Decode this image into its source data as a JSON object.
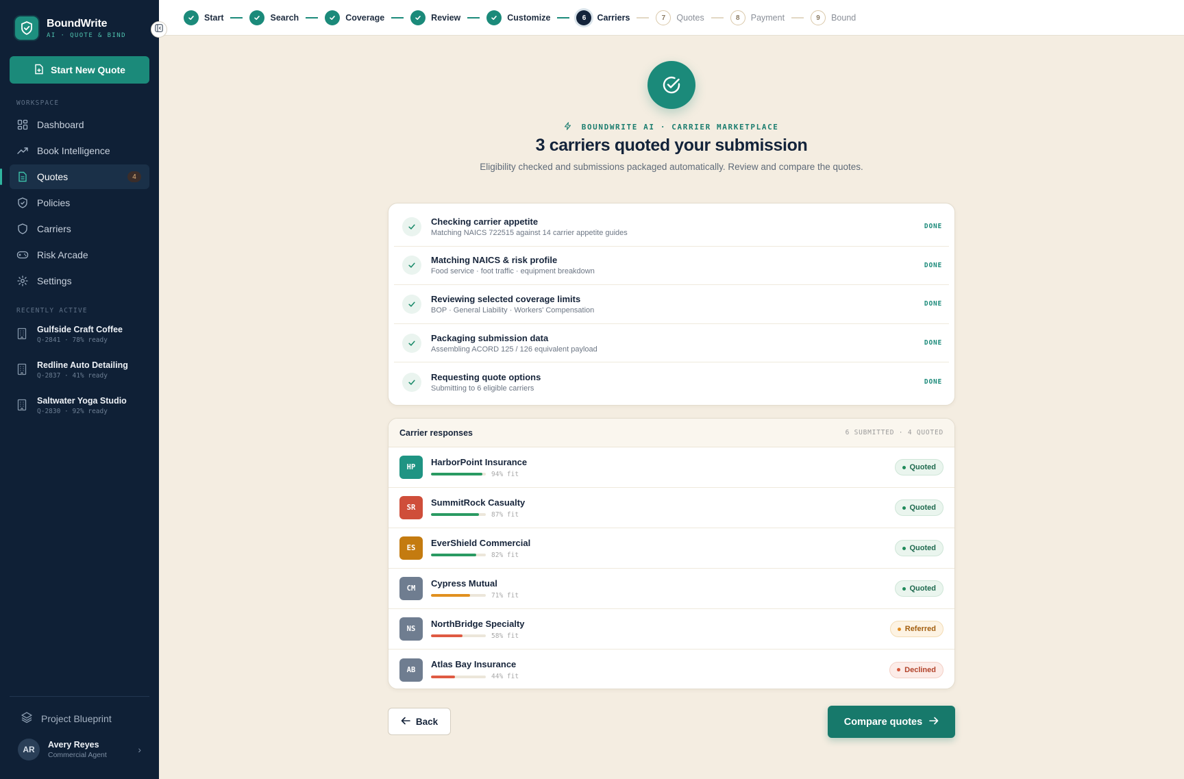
{
  "brand": {
    "name": "BoundWrite",
    "tagline": "AI · QUOTE & BIND"
  },
  "sidebar": {
    "new_quote_label": "Start New Quote",
    "workspace_label": "WORKSPACE",
    "nav": [
      {
        "label": "Dashboard",
        "icon": "grid-icon"
      },
      {
        "label": "Book Intelligence",
        "icon": "trend-icon"
      },
      {
        "label": "Quotes",
        "icon": "document-icon",
        "badge": "4",
        "active": true
      },
      {
        "label": "Policies",
        "icon": "shield-check-icon"
      },
      {
        "label": "Carriers",
        "icon": "shield-icon"
      },
      {
        "label": "Risk Arcade",
        "icon": "gamepad-icon"
      },
      {
        "label": "Settings",
        "icon": "gear-icon"
      }
    ],
    "recent_label": "RECENTLY ACTIVE",
    "recent": [
      {
        "name": "Gulfside Craft Coffee",
        "meta": "Q-2841 · 78% ready"
      },
      {
        "name": "Redline Auto Detailing",
        "meta": "Q-2837 · 41% ready"
      },
      {
        "name": "Saltwater Yoga Studio",
        "meta": "Q-2830 · 92% ready"
      }
    ],
    "blueprint_label": "Project Blueprint",
    "user": {
      "initials": "AR",
      "name": "Avery Reyes",
      "role": "Commercial Agent"
    }
  },
  "stepper": [
    {
      "label": "Start",
      "state": "done"
    },
    {
      "label": "Search",
      "state": "done"
    },
    {
      "label": "Coverage",
      "state": "done"
    },
    {
      "label": "Review",
      "state": "done"
    },
    {
      "label": "Customize",
      "state": "done"
    },
    {
      "number": "6",
      "label": "Carriers",
      "state": "current"
    },
    {
      "number": "7",
      "label": "Quotes",
      "state": "todo"
    },
    {
      "number": "8",
      "label": "Payment",
      "state": "todo"
    },
    {
      "number": "9",
      "label": "Bound",
      "state": "todo"
    }
  ],
  "header": {
    "eyebrow": "BOUNDWRITE AI · CARRIER MARKETPLACE",
    "title": "3 carriers quoted your submission",
    "subtitle": "Eligibility checked and submissions packaged automatically. Review and compare the quotes."
  },
  "checks": [
    {
      "title": "Checking carrier appetite",
      "sub": "Matching NAICS 722515 against 14 carrier appetite guides",
      "status": "DONE"
    },
    {
      "title": "Matching NAICS & risk profile",
      "sub": "Food service · foot traffic · equipment breakdown",
      "status": "DONE"
    },
    {
      "title": "Reviewing selected coverage limits",
      "sub": "BOP · General Liability · Workers' Compensation",
      "status": "DONE"
    },
    {
      "title": "Packaging submission data",
      "sub": "Assembling ACORD 125 / 126 equivalent payload",
      "status": "DONE"
    },
    {
      "title": "Requesting quote options",
      "sub": "Submitting to 6 eligible carriers",
      "status": "DONE"
    }
  ],
  "responses": {
    "title": "Carrier responses",
    "counts": "6 SUBMITTED · 4 QUOTED",
    "carriers": [
      {
        "initials": "HP",
        "name": "HarborPoint Insurance",
        "fit": 94,
        "fit_label": "94% fit",
        "status": "Quoted",
        "status_key": "quoted",
        "badge_color": "#1f9483",
        "bar_color": "#2a9a62"
      },
      {
        "initials": "SR",
        "name": "SummitRock Casualty",
        "fit": 87,
        "fit_label": "87% fit",
        "status": "Quoted",
        "status_key": "quoted",
        "badge_color": "#cf4e3a",
        "bar_color": "#2a9a62"
      },
      {
        "initials": "ES",
        "name": "EverShield Commercial",
        "fit": 82,
        "fit_label": "82% fit",
        "status": "Quoted",
        "status_key": "quoted",
        "badge_color": "#c47b10",
        "bar_color": "#2a9a62"
      },
      {
        "initials": "CM",
        "name": "Cypress Mutual",
        "fit": 71,
        "fit_label": "71% fit",
        "status": "Quoted",
        "status_key": "quoted",
        "badge_color": "#6f7d90",
        "bar_color": "#e0901f"
      },
      {
        "initials": "NS",
        "name": "NorthBridge Specialty",
        "fit": 58,
        "fit_label": "58% fit",
        "status": "Referred",
        "status_key": "referred",
        "badge_color": "#6f7d90",
        "bar_color": "#df5a42"
      },
      {
        "initials": "AB",
        "name": "Atlas Bay Insurance",
        "fit": 44,
        "fit_label": "44% fit",
        "status": "Declined",
        "status_key": "declined",
        "badge_color": "#6f7d90",
        "bar_color": "#df5a42"
      }
    ]
  },
  "actions": {
    "back_label": "Back",
    "compare_label": "Compare quotes"
  }
}
